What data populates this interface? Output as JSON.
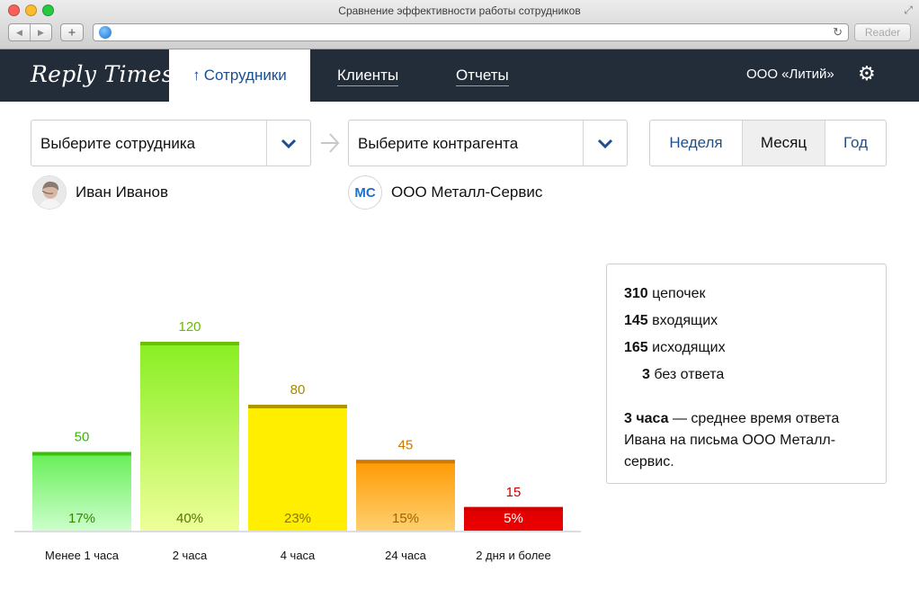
{
  "window": {
    "title": "Сравнение эффективности работы сотрудников",
    "reader_label": "Reader"
  },
  "nav": {
    "logo": "Reply Times",
    "active_tab": "Сотрудники",
    "tabs": [
      "Клиенты",
      "Отчеты"
    ],
    "company": "ООО «Литий»"
  },
  "filters": {
    "employee_select": "Выберите сотрудника",
    "counterparty_select": "Выберите контрагента",
    "periods": [
      "Неделя",
      "Месяц",
      "Год"
    ],
    "active_period": "Месяц",
    "employee_name": "Иван Иванов",
    "counterparty_name": "ООО Металл-Сервис",
    "counterparty_logo": "МС"
  },
  "stats": {
    "chains_value": "310",
    "chains_label": "цепочек",
    "incoming_value": "145",
    "incoming_label": "входящих",
    "outgoing_value": "165",
    "outgoing_label": "исходящих",
    "unanswered_value": "3",
    "unanswered_label": "без ответа",
    "avg_value": "3 часа",
    "avg_text": " — среднее время ответа Ивана на письма ООО Металл-сервис."
  },
  "chart_data": {
    "type": "bar",
    "categories": [
      "Менее 1 часа",
      "2 часа",
      "4 часа",
      "24 часа",
      "2 дня и более"
    ],
    "values": [
      50,
      120,
      80,
      45,
      15
    ],
    "percent_labels": [
      "17%",
      "40%",
      "23%",
      "15%",
      "5%"
    ],
    "colors": {
      "top": [
        "#66ee55",
        "#88ee22",
        "#ffee00",
        "#ff9900",
        "#dd0000"
      ],
      "bottom": [
        "#ccffcc",
        "#eeff99",
        "#ffee00",
        "#ffd070",
        "#ee0000"
      ],
      "label": [
        "#33bb00",
        "#66bb00",
        "#aa8800",
        "#cc7700",
        "#cc0000"
      ],
      "pct": [
        "#338800",
        "#557700",
        "#887700",
        "#996600",
        "#ffffff"
      ]
    }
  }
}
